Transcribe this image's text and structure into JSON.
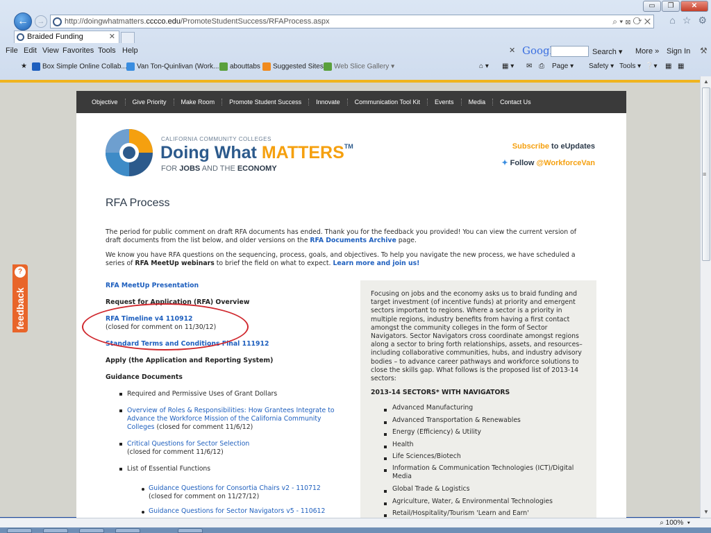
{
  "browser": {
    "url_prefix": "http://doingwhatmatters.",
    "url_domain": "cccco.edu",
    "url_path": "/PromoteStudentSuccess/RFAProcess.aspx",
    "address_tools": "⌕ ▾ ⊠ ⟳ ✕",
    "toolbar_icons": [
      "⌂",
      "☆",
      "⚙"
    ],
    "tab_title": "Braided Funding",
    "tab_close": "✕",
    "window_controls": [
      "▭",
      "❐",
      "✕"
    ],
    "menu": [
      "File",
      "Edit",
      "View",
      "Favorites",
      "Tools",
      "Help"
    ],
    "google": {
      "close": "✕",
      "logo": "Google",
      "search_label": "Search ▾",
      "more_label": "More »",
      "signin_label": "Sign In"
    },
    "favorites": [
      "Box Simple Online Collab...",
      "Van Ton-Quinlivan (Work...",
      "abouttabs",
      "Suggested Sites ▾",
      "Web Slice Gallery ▾"
    ],
    "commands": [
      "▾",
      "▾",
      "Page ▾",
      "Safety ▾",
      "Tools ▾",
      "▾"
    ],
    "zoom": "100%",
    "zoom_arrow": "▾",
    "colors": {
      "chrome": "#dbe6f4",
      "accent_orange": "#f5a00f",
      "link_blue": "#1e5fbe",
      "nav_dark": "#3a3a3a",
      "circle_red": "#d0282e"
    }
  },
  "site": {
    "nav": [
      "Objective",
      "Give Priority",
      "Make Room",
      "Promote Student Success",
      "Innovate",
      "Communication Tool Kit",
      "Events",
      "Media",
      "Contact Us"
    ],
    "logo": {
      "small": "CALIFORNIA COMMUNITY COLLEGES",
      "main_a": "Doing What ",
      "main_b": "MATTERS",
      "tm": "TM",
      "sub_a": "FOR ",
      "sub_b": "JOBS",
      "sub_c": " AND THE ",
      "sub_d": "ECONOMY"
    },
    "subscribe_a": "Subscribe",
    "subscribe_b": " to eUpdates",
    "follow_a": "Follow ",
    "follow_b": "@WorkforceVan",
    "feedback_label": "feedback",
    "feedback_icon": "?"
  },
  "content": {
    "title": "RFA Process",
    "p1_a": "The period for public comment on draft RFA documents has ended. Thank you for the feedback you provided! You can view the current version of draft documents from the list below, and older versions on the ",
    "p1_link": "RFA Documents Archive",
    "p1_b": " page.",
    "p2_a": "We know you have RFA questions on the sequencing, process, goals, and objectives. To help you navigate the new process, we have scheduled a series of ",
    "p2_bold": "RFA MeetUp webinars",
    "p2_b": " to brief the field on what to expect. ",
    "p2_link": "Learn more and join us!",
    "left": {
      "meetup": "RFA MeetUp Presentation",
      "overview": "Request for Application (RFA) Overview",
      "timeline": "RFA Timeline v4 110912",
      "timeline_note": "(closed for comment on 11/30/12)",
      "terms": "Standard Terms and Conditions Final 111912",
      "apply": "Apply (the Application and Reporting System)",
      "guidance": "Guidance Documents",
      "g1": "Required and Permissive Uses of Grant Dollars",
      "g2_l1": "Overview of Roles & Responsibilities: How Grantees Integrate to",
      "g2_l2": "Advance the Workforce Mission of the California Community",
      "g2_l3": "Colleges",
      "g2_note": " (closed for comment 11/6/12)",
      "g3": "Critical Questions for Sector Selection",
      "g3_note": "(closed for comment 11/6/12)",
      "g4": "List of Essential Functions",
      "s1": "Guidance Questions for Consortia Chairs v2 - 110712",
      "s1_note": "(closed for comment on 11/27/12)",
      "s2": "Guidance Questions for Sector Navigators v5 - 110612"
    },
    "right": {
      "intro": "Focusing on jobs and the economy asks us to braid funding and target investment (of incentive funds) at priority and emergent sectors important to regions. Where a sector is a priority in multiple regions, industry benefits from having a first contact amongst the community colleges in the form of Sector Navigators. Sector Navigators cross coordinate amongst regions along a sector to bring forth relationships, assets, and resources– including collaborative communities, hubs, and industry advisory bodies – to advance career pathways and workforce solutions to close the skills gap. What follows is the proposed list of 2013-14 sectors:",
      "heading": "2013-14 SECTORS* WITH NAVIGATORS",
      "sectors": [
        "Advanced Manufacturing",
        "Advanced Transportation & Renewables",
        "Energy (Efficiency) & Utility",
        "Health",
        "Life Sciences/Biotech",
        "Information & Communication Technologies (ICT)/Digital",
        "Media",
        "Global Trade & Logistics",
        "Agriculture, Water, & Environmental Technologies",
        "Retail/Hospitality/Tourism 'Learn and Earn'"
      ]
    }
  }
}
